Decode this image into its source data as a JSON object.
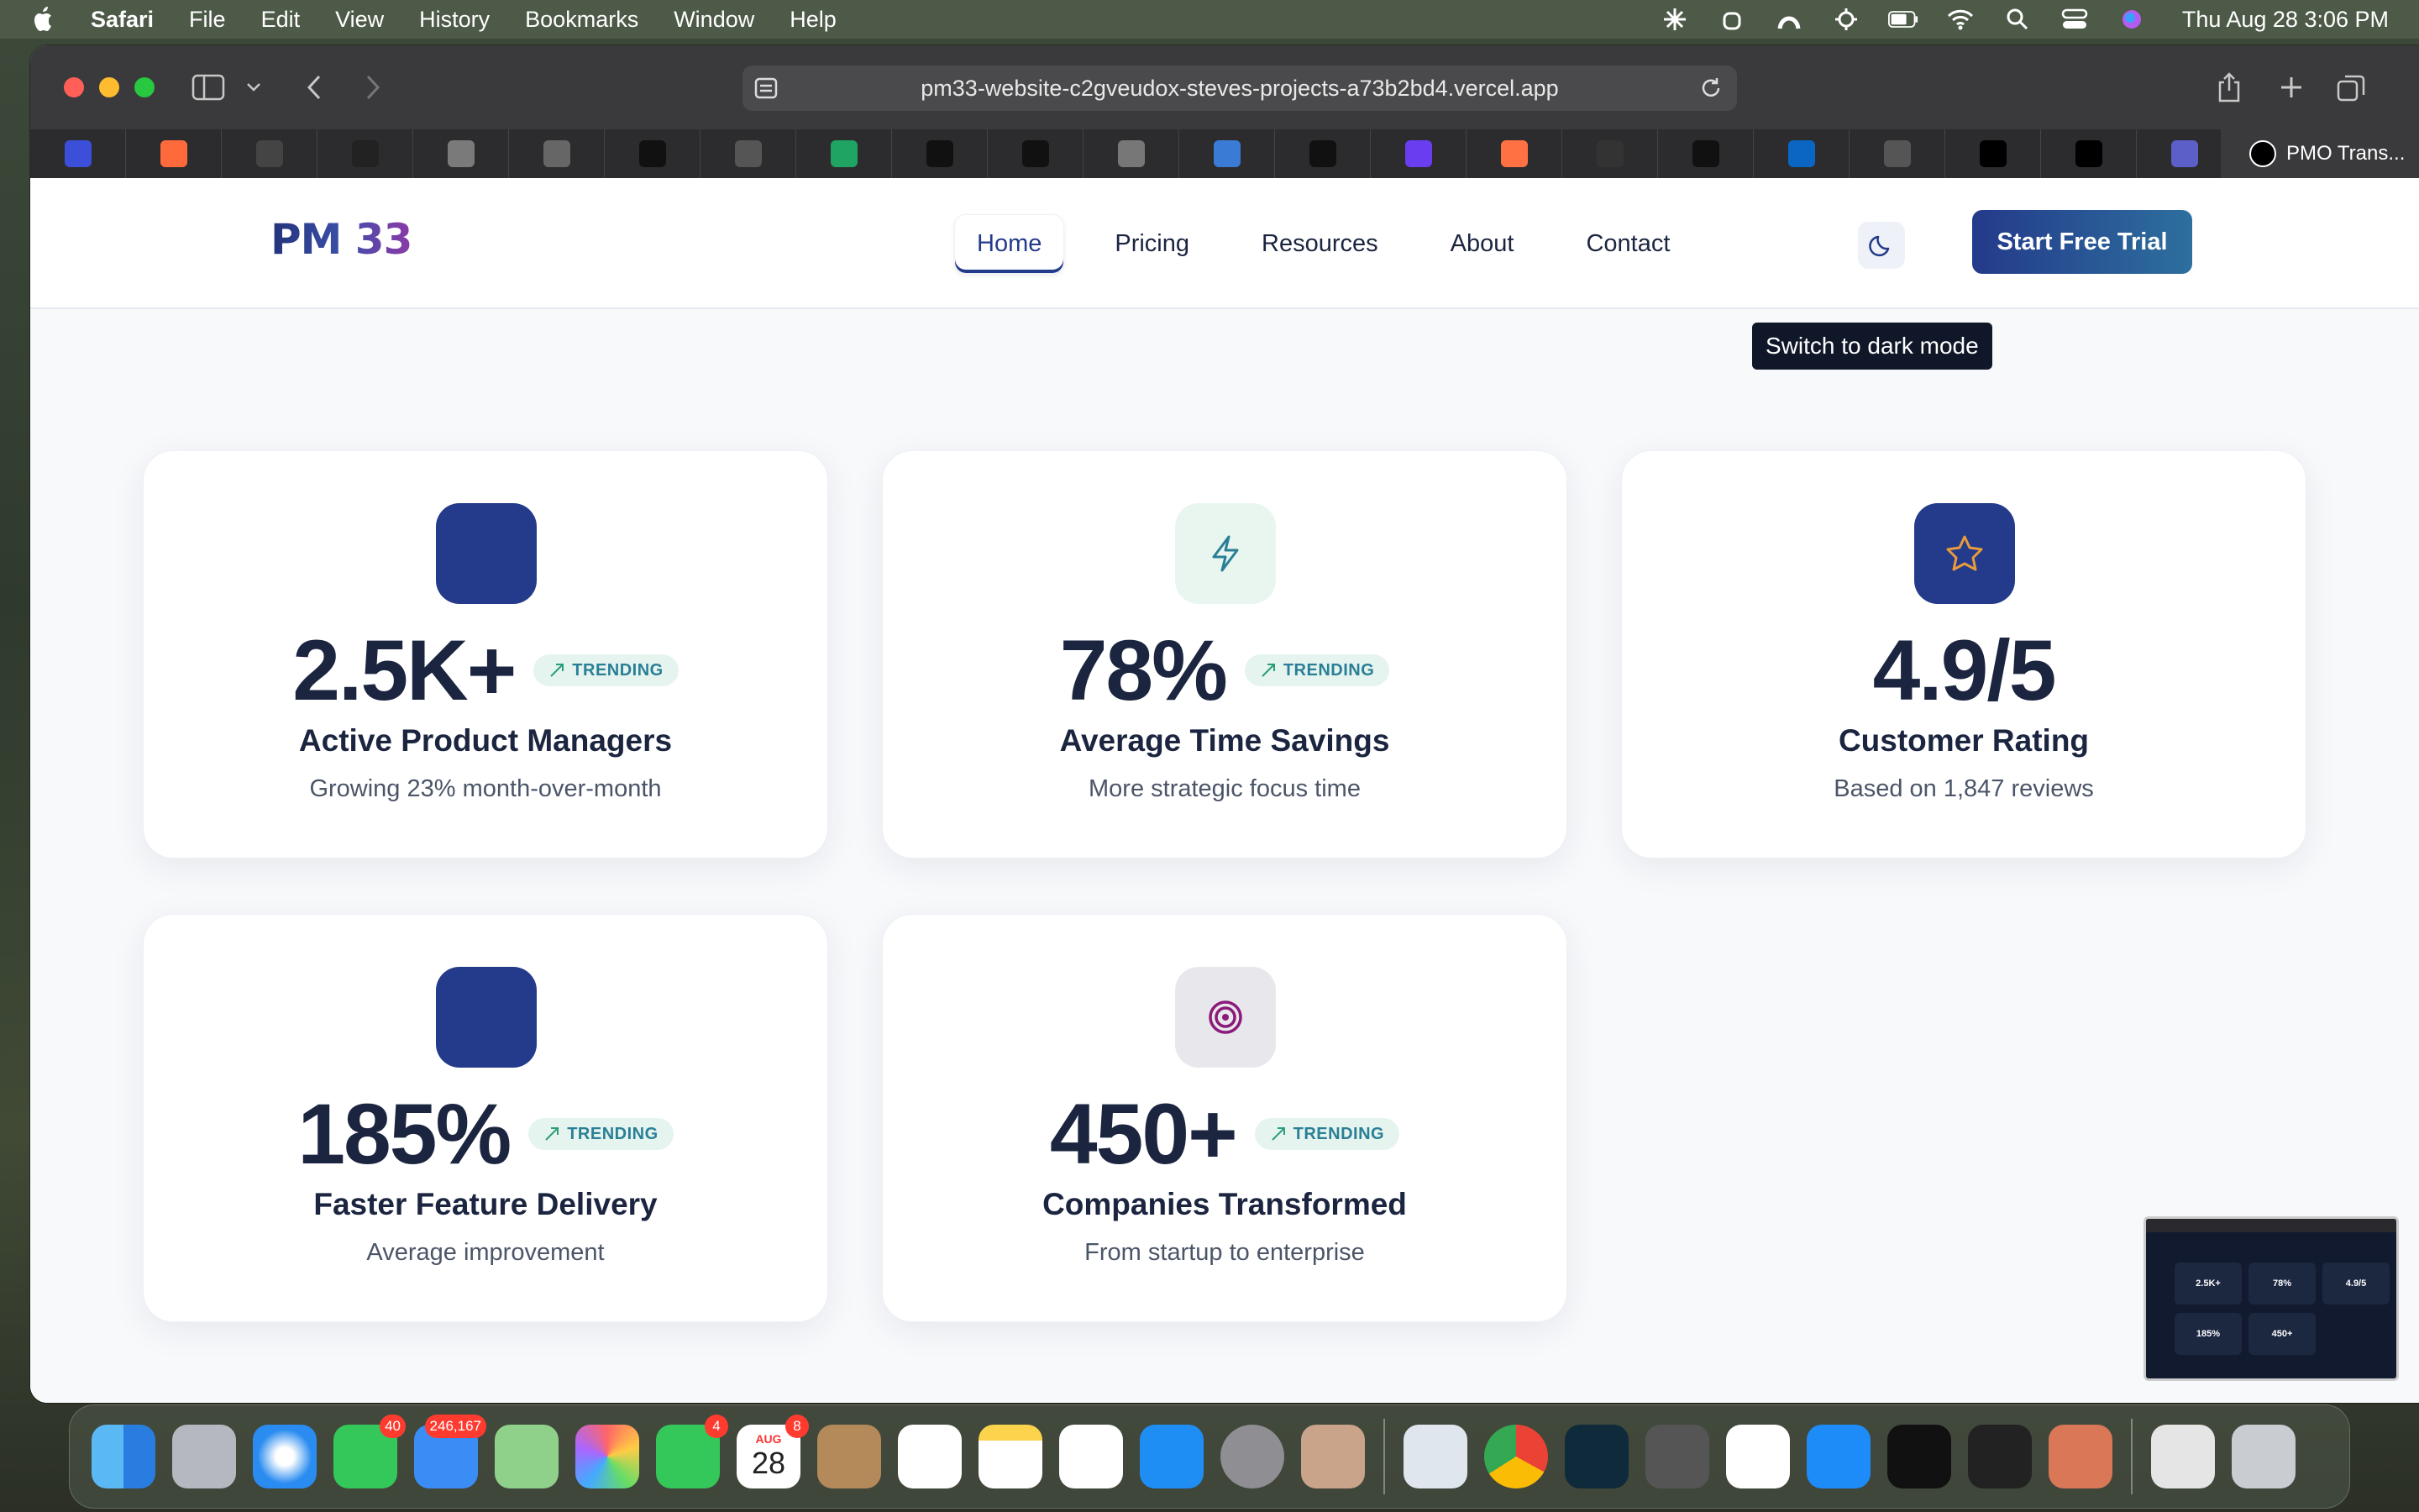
{
  "menubar": {
    "app": "Safari",
    "items": [
      "File",
      "Edit",
      "View",
      "History",
      "Bookmarks",
      "Window",
      "Help"
    ],
    "clock": "Thu Aug 28  3:06 PM"
  },
  "browser": {
    "url": "pm33-website-c2gveudox-steves-projects-a73b2bd4.vercel.app",
    "active_tab": "PMO Trans...",
    "tab_favicon_colors": [
      "#3b4fd8",
      "#ff6a3d",
      "#444",
      "#222",
      "#7a7a7a",
      "#666",
      "#111",
      "#555",
      "#1fa463",
      "#111",
      "#111",
      "#777",
      "#3a7bd5",
      "#111",
      "#6a3df0",
      "#ff7043",
      "#333",
      "#111",
      "#0a66c2",
      "#555",
      "#000",
      "#000",
      "#5b5fc7"
    ]
  },
  "nav": {
    "logo": "PM 33",
    "links": [
      "Home",
      "Pricing",
      "Resources",
      "About",
      "Contact"
    ],
    "active": "Home",
    "cta": "Start Free Trial",
    "tooltip": "Switch to dark mode"
  },
  "stats": [
    {
      "value": "2.5K+",
      "badge": "TRENDING",
      "title": "Active Product Managers",
      "sub": "Growing 23% month-over-month",
      "icon": "blank",
      "icon_bg": "#243a8a"
    },
    {
      "value": "78%",
      "badge": "TRENDING",
      "title": "Average Time Savings",
      "sub": "More strategic focus time",
      "icon": "lightning-icon",
      "icon_bg": "#e9f6ef"
    },
    {
      "value": "4.9/5",
      "badge": "",
      "title": "Customer Rating",
      "sub": "Based on 1,847 reviews",
      "icon": "star-icon",
      "icon_bg": "#243a8a"
    },
    {
      "value": "185%",
      "badge": "TRENDING",
      "title": "Faster Feature Delivery",
      "sub": "Average improvement",
      "icon": "blank",
      "icon_bg": "#243a8a"
    },
    {
      "value": "450+",
      "badge": "TRENDING",
      "title": "Companies Transformed",
      "sub": "From startup to enterprise",
      "icon": "target-icon",
      "icon_bg": "#e8e8ec"
    }
  ],
  "pip": {
    "labels": [
      "2.5K+",
      "78%",
      "4.9/5",
      "185%",
      "450+"
    ]
  },
  "dock": {
    "badges": {
      "messages": "40",
      "mail": "246,167",
      "facetime": "4",
      "calendar": "8"
    },
    "calendar_month": "AUG",
    "calendar_day": "28"
  }
}
